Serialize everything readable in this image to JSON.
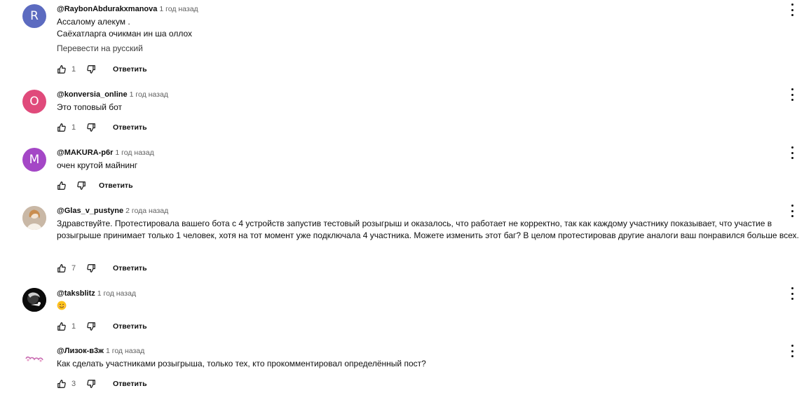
{
  "comments": [
    {
      "avatar_letter": "R",
      "avatar_color": "#5c6bc0",
      "author": "@RaybonAbdurakxmanova",
      "time": "1 год назад",
      "lines": [
        "Ассалому алекум .",
        "Саёхатларга очикман ин ша оллох"
      ],
      "translate": "Перевести на русский",
      "likes": "1",
      "reply": "Ответить"
    },
    {
      "avatar_letter": "O",
      "avatar_color": "#e04a7b",
      "author": "@konversia_online",
      "time": "1 год назад",
      "lines": [
        "Это топовый бот"
      ],
      "likes": "1",
      "reply": "Ответить"
    },
    {
      "avatar_letter": "M",
      "avatar_color": "#a447c6",
      "author": "@MAKURA-p6r",
      "time": "1 год назад",
      "lines": [
        "очен крутой майнинг"
      ],
      "likes": "",
      "reply": "Ответить"
    },
    {
      "avatar_icon": "photo-avatar",
      "author": "@Glas_v_pustyne",
      "time": "2 года назад",
      "lines": [
        "Здравствуйте. Протестировала вашего бота с 4 устройств запустив тестовый розыгрыш и оказалось, что работает не корректно, так как каждому участнику показывает, что участие в розыгрыше принимает только 1 человек, хотя на тот момент уже подключала 4 участника. Можете изменить этот баг? В целом протестировав другие аналоги ваш понравился больше всех."
      ],
      "likes": "7",
      "reply": "Ответить"
    },
    {
      "avatar_icon": "photo-avatar",
      "author": "@taksblitz",
      "time": "1 год назад",
      "lines": [
        ""
      ],
      "emoji": "smiling-face-emoji",
      "likes": "1",
      "reply": "Ответить"
    },
    {
      "avatar_icon": "photo-avatar",
      "author": "@Лизок-в3ж",
      "time": "1 год назад",
      "lines": [
        "Как сделать участниками розыгрыша, только тех, кто прокомментировал определённый пост?"
      ],
      "likes": "3",
      "reply": "Ответить"
    }
  ],
  "icons": {
    "like": "thumb-up-icon",
    "dislike": "thumb-down-icon",
    "menu": "more-vert-icon"
  }
}
